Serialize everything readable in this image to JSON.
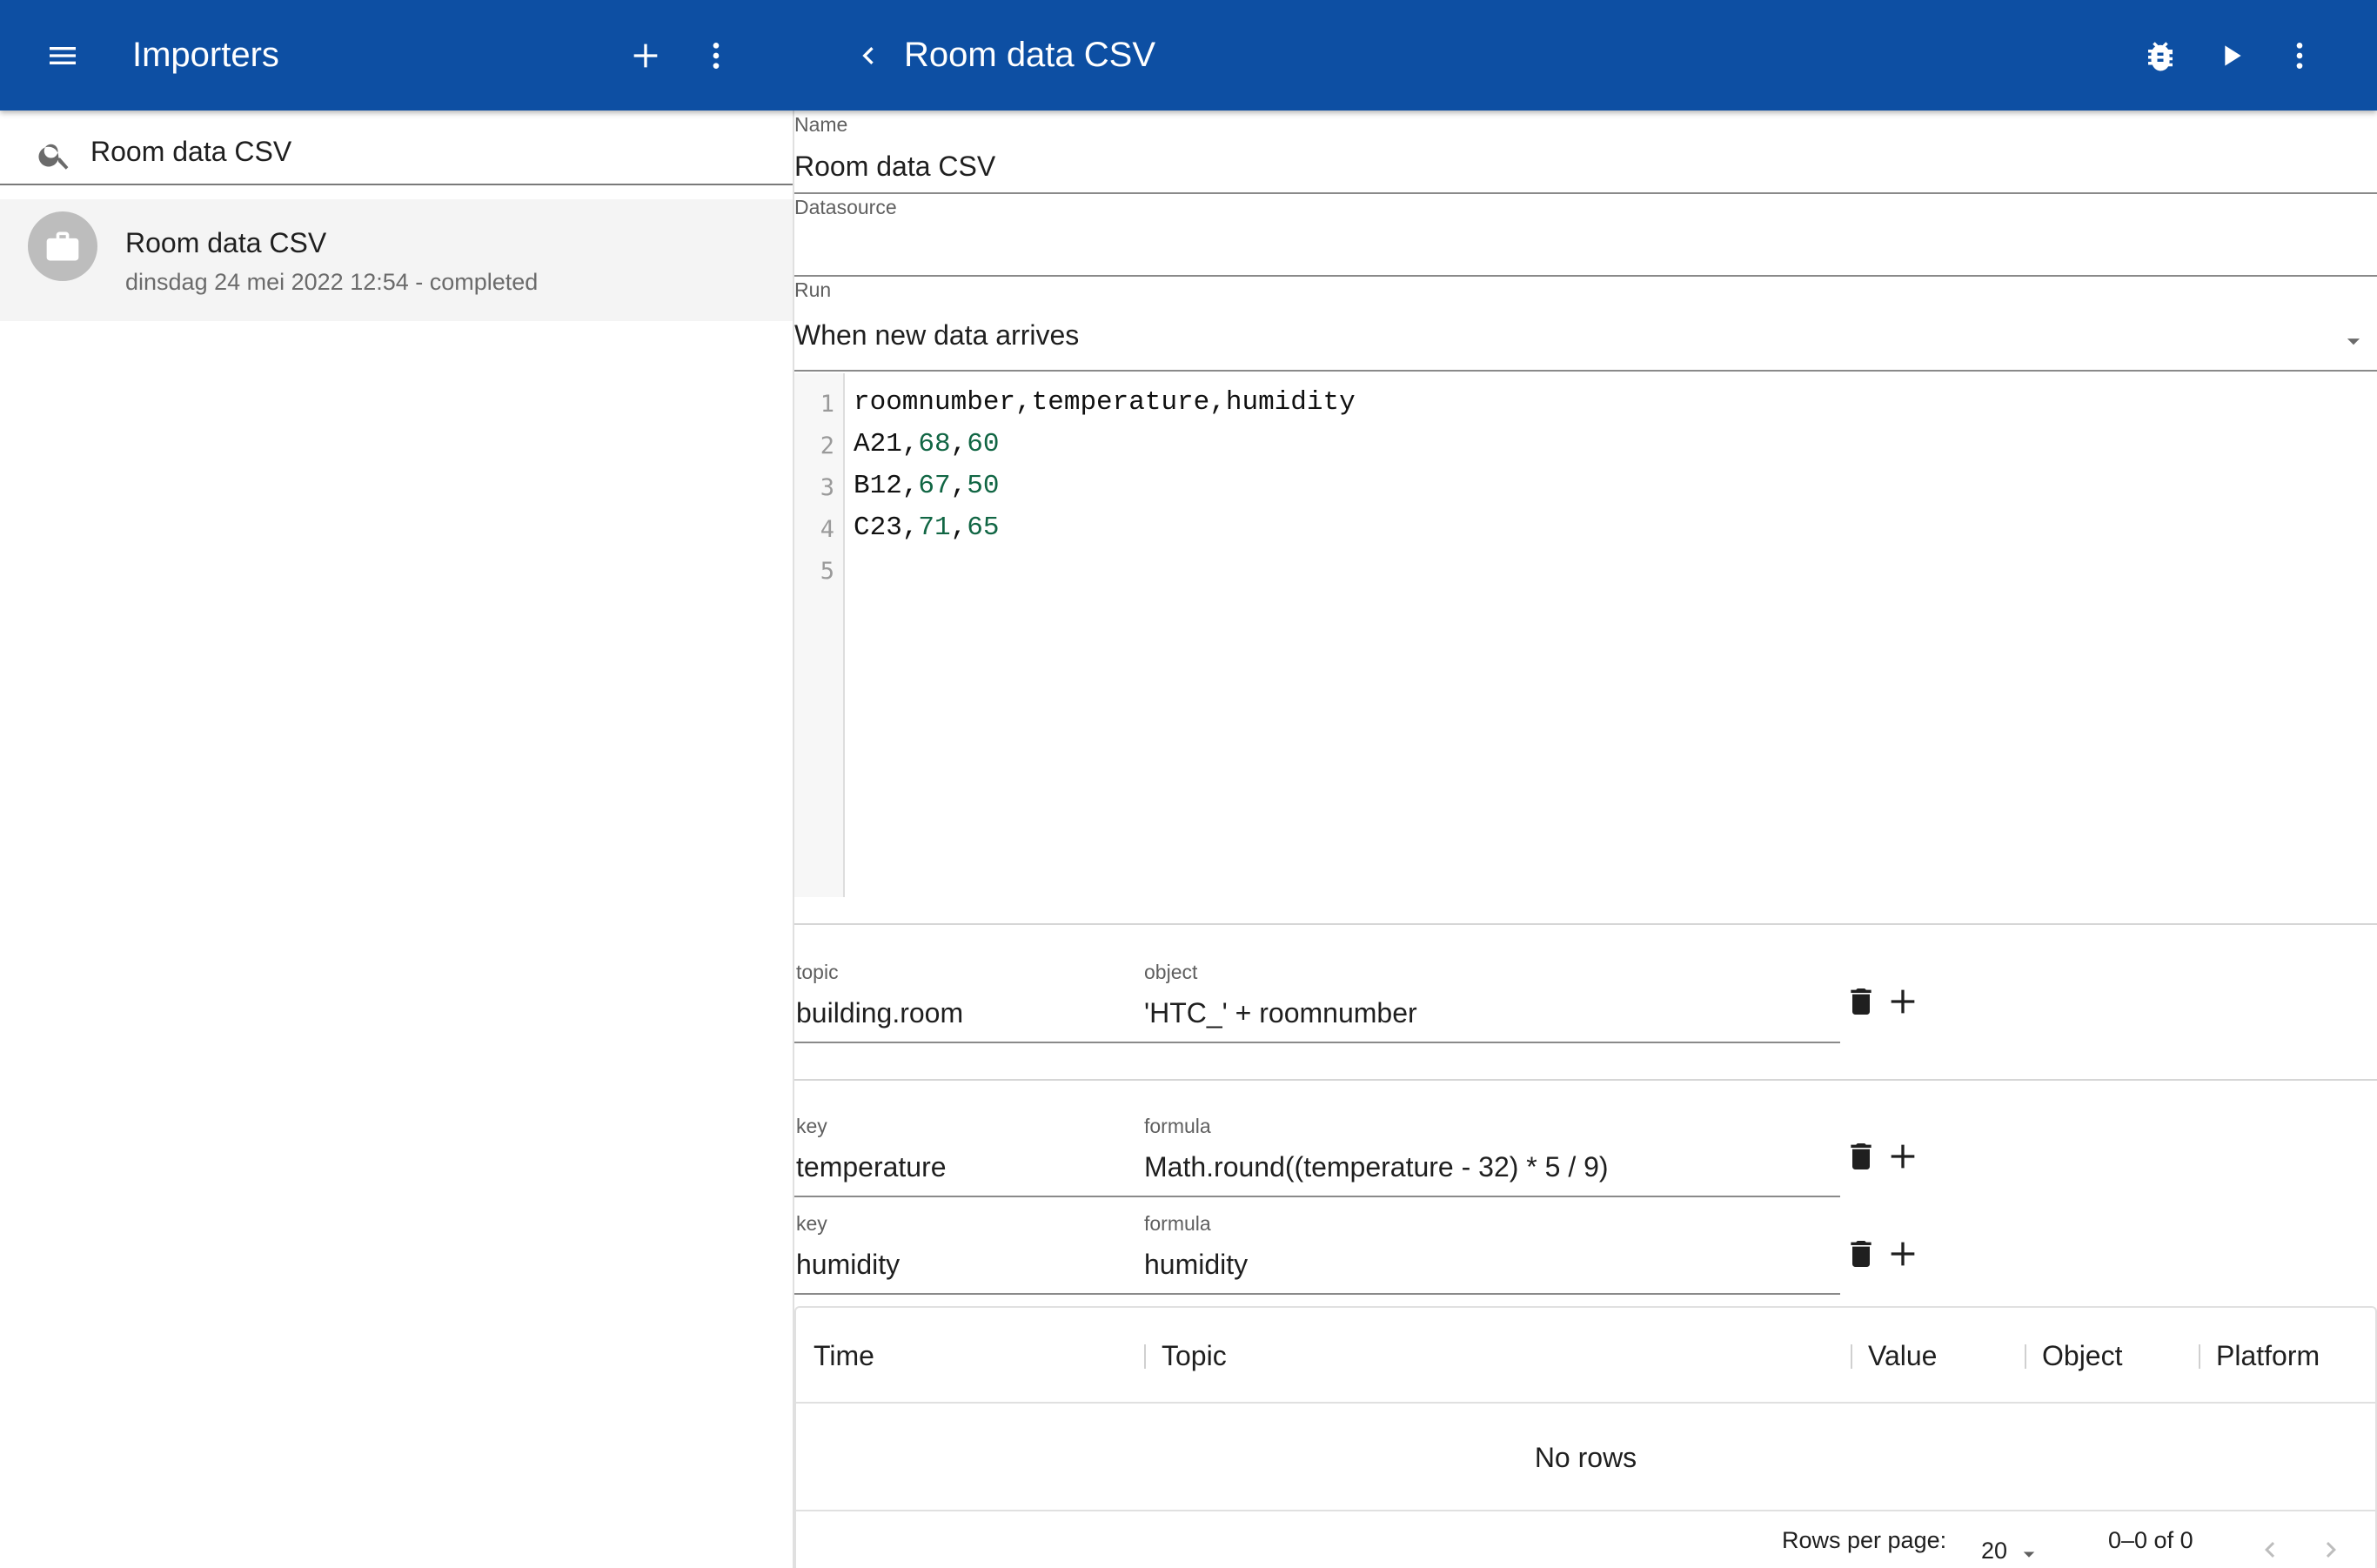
{
  "app_bar": {
    "left_title": "Importers",
    "detail_title": "Room data CSV"
  },
  "search": {
    "value": "Room data CSV"
  },
  "importer_list": [
    {
      "name": "Room data CSV",
      "subtitle": "dinsdag 24 mei 2022 12:54 - completed"
    }
  ],
  "form": {
    "name_label": "Name",
    "name_value": "Room data CSV",
    "datasource_label": "Datasource",
    "datasource_value": "",
    "run_label": "Run",
    "run_value": "When new data arrives"
  },
  "code_editor": {
    "line_numbers": [
      "1",
      "2",
      "3",
      "4",
      "5"
    ],
    "header": "roomnumber,temperature,humidity",
    "rows": [
      {
        "room": "A21",
        "temperature": "68",
        "humidity": "60"
      },
      {
        "room": "B12",
        "temperature": "67",
        "humidity": "50"
      },
      {
        "room": "C23",
        "temperature": "71",
        "humidity": "65"
      }
    ],
    "comma": ","
  },
  "topic_mapping": {
    "topic_label": "topic",
    "topic_value": "building.room",
    "object_label": "object",
    "object_value": "'HTC_' + roomnumber"
  },
  "value_mappings": [
    {
      "key_label": "key",
      "key_value": "temperature",
      "formula_label": "formula",
      "formula_value": "Math.round((temperature - 32) * 5 / 9)"
    },
    {
      "key_label": "key",
      "key_value": "humidity",
      "formula_label": "formula",
      "formula_value": "humidity"
    }
  ],
  "results_table": {
    "columns": [
      "Time",
      "Topic",
      "Value",
      "Object",
      "Platform"
    ],
    "empty_text": "No rows",
    "rows_per_page_label": "Rows per page:",
    "rows_per_page_value": "20",
    "range_text": "0–0 of 0"
  },
  "colors": {
    "app_bar": "#0d4fa3",
    "csv_number": "#116644",
    "selected_row": "#f4f4f4"
  },
  "icons": [
    "menu-icon",
    "plus-icon",
    "more-vert-icon",
    "chevron-left-icon",
    "bug-icon",
    "play-icon",
    "search-icon",
    "briefcase-icon",
    "delete-icon",
    "dropdown-arrow-icon"
  ]
}
